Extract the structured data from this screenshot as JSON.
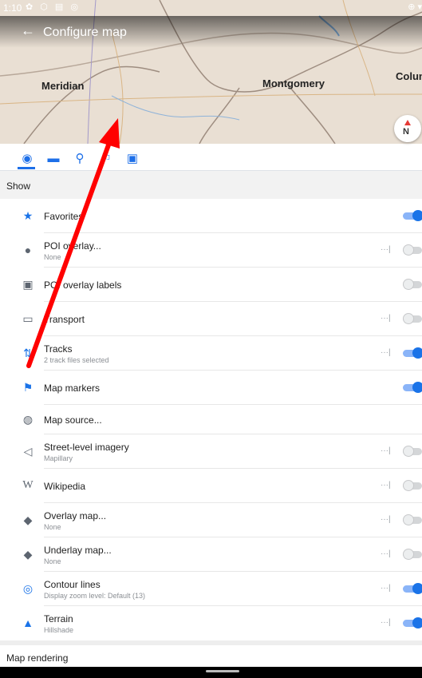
{
  "status_bar": {
    "time": "1:10",
    "left_icons": "✿ ⬡ ▤ ◎",
    "right_icons": "⊕ ▾"
  },
  "app_bar": {
    "title": "Configure map",
    "back_icon": "arrow-back-icon"
  },
  "map": {
    "cities": [
      "Meridian",
      "Montgomery",
      "Colum"
    ],
    "compass_label": "N"
  },
  "tabs": [
    {
      "icon": "globe-icon",
      "glyph": "◉"
    },
    {
      "icon": "car-icon",
      "glyph": "▬"
    },
    {
      "icon": "bicycle-icon",
      "glyph": "⚲"
    },
    {
      "icon": "pedestrian-icon",
      "glyph": "⚐"
    },
    {
      "icon": "bus-icon",
      "glyph": "▣"
    }
  ],
  "sections": {
    "show": "Show",
    "map_rendering": "Map rendering"
  },
  "items": [
    {
      "label": "Favorites",
      "icon": "star-icon",
      "enabled": true
    },
    {
      "label": "POI overlay...",
      "sub": "None",
      "icon": "info-icon",
      "enabled": false
    },
    {
      "label": "POI overlay labels",
      "icon": "label-icon",
      "enabled": false
    },
    {
      "label": "Transport",
      "icon": "bus-icon",
      "enabled": false
    },
    {
      "label": "Tracks",
      "sub": "2 track files selected",
      "icon": "tracks-icon",
      "enabled": true
    },
    {
      "label": "Map markers",
      "icon": "flag-icon",
      "enabled": true
    },
    {
      "label": "Map source...",
      "icon": "globe-icon"
    },
    {
      "label": "Street-level imagery",
      "sub": "Mapillary",
      "icon": "street-imagery-icon",
      "enabled": false
    },
    {
      "label": "Wikipedia",
      "icon": "wikipedia-icon",
      "enabled": false
    },
    {
      "label": "Overlay map...",
      "sub": "None",
      "icon": "layers-icon",
      "enabled": false
    },
    {
      "label": "Underlay map...",
      "sub": "None",
      "icon": "layers-icon",
      "enabled": false
    },
    {
      "label": "Contour lines",
      "sub": "Display zoom level: Default (13)",
      "icon": "contour-icon",
      "enabled": true
    },
    {
      "label": "Terrain",
      "sub": "Hillshade",
      "icon": "terrain-icon",
      "enabled": true
    }
  ],
  "colors": {
    "accent": "#1a73e8",
    "annotation_arrow": "#ff0000"
  }
}
